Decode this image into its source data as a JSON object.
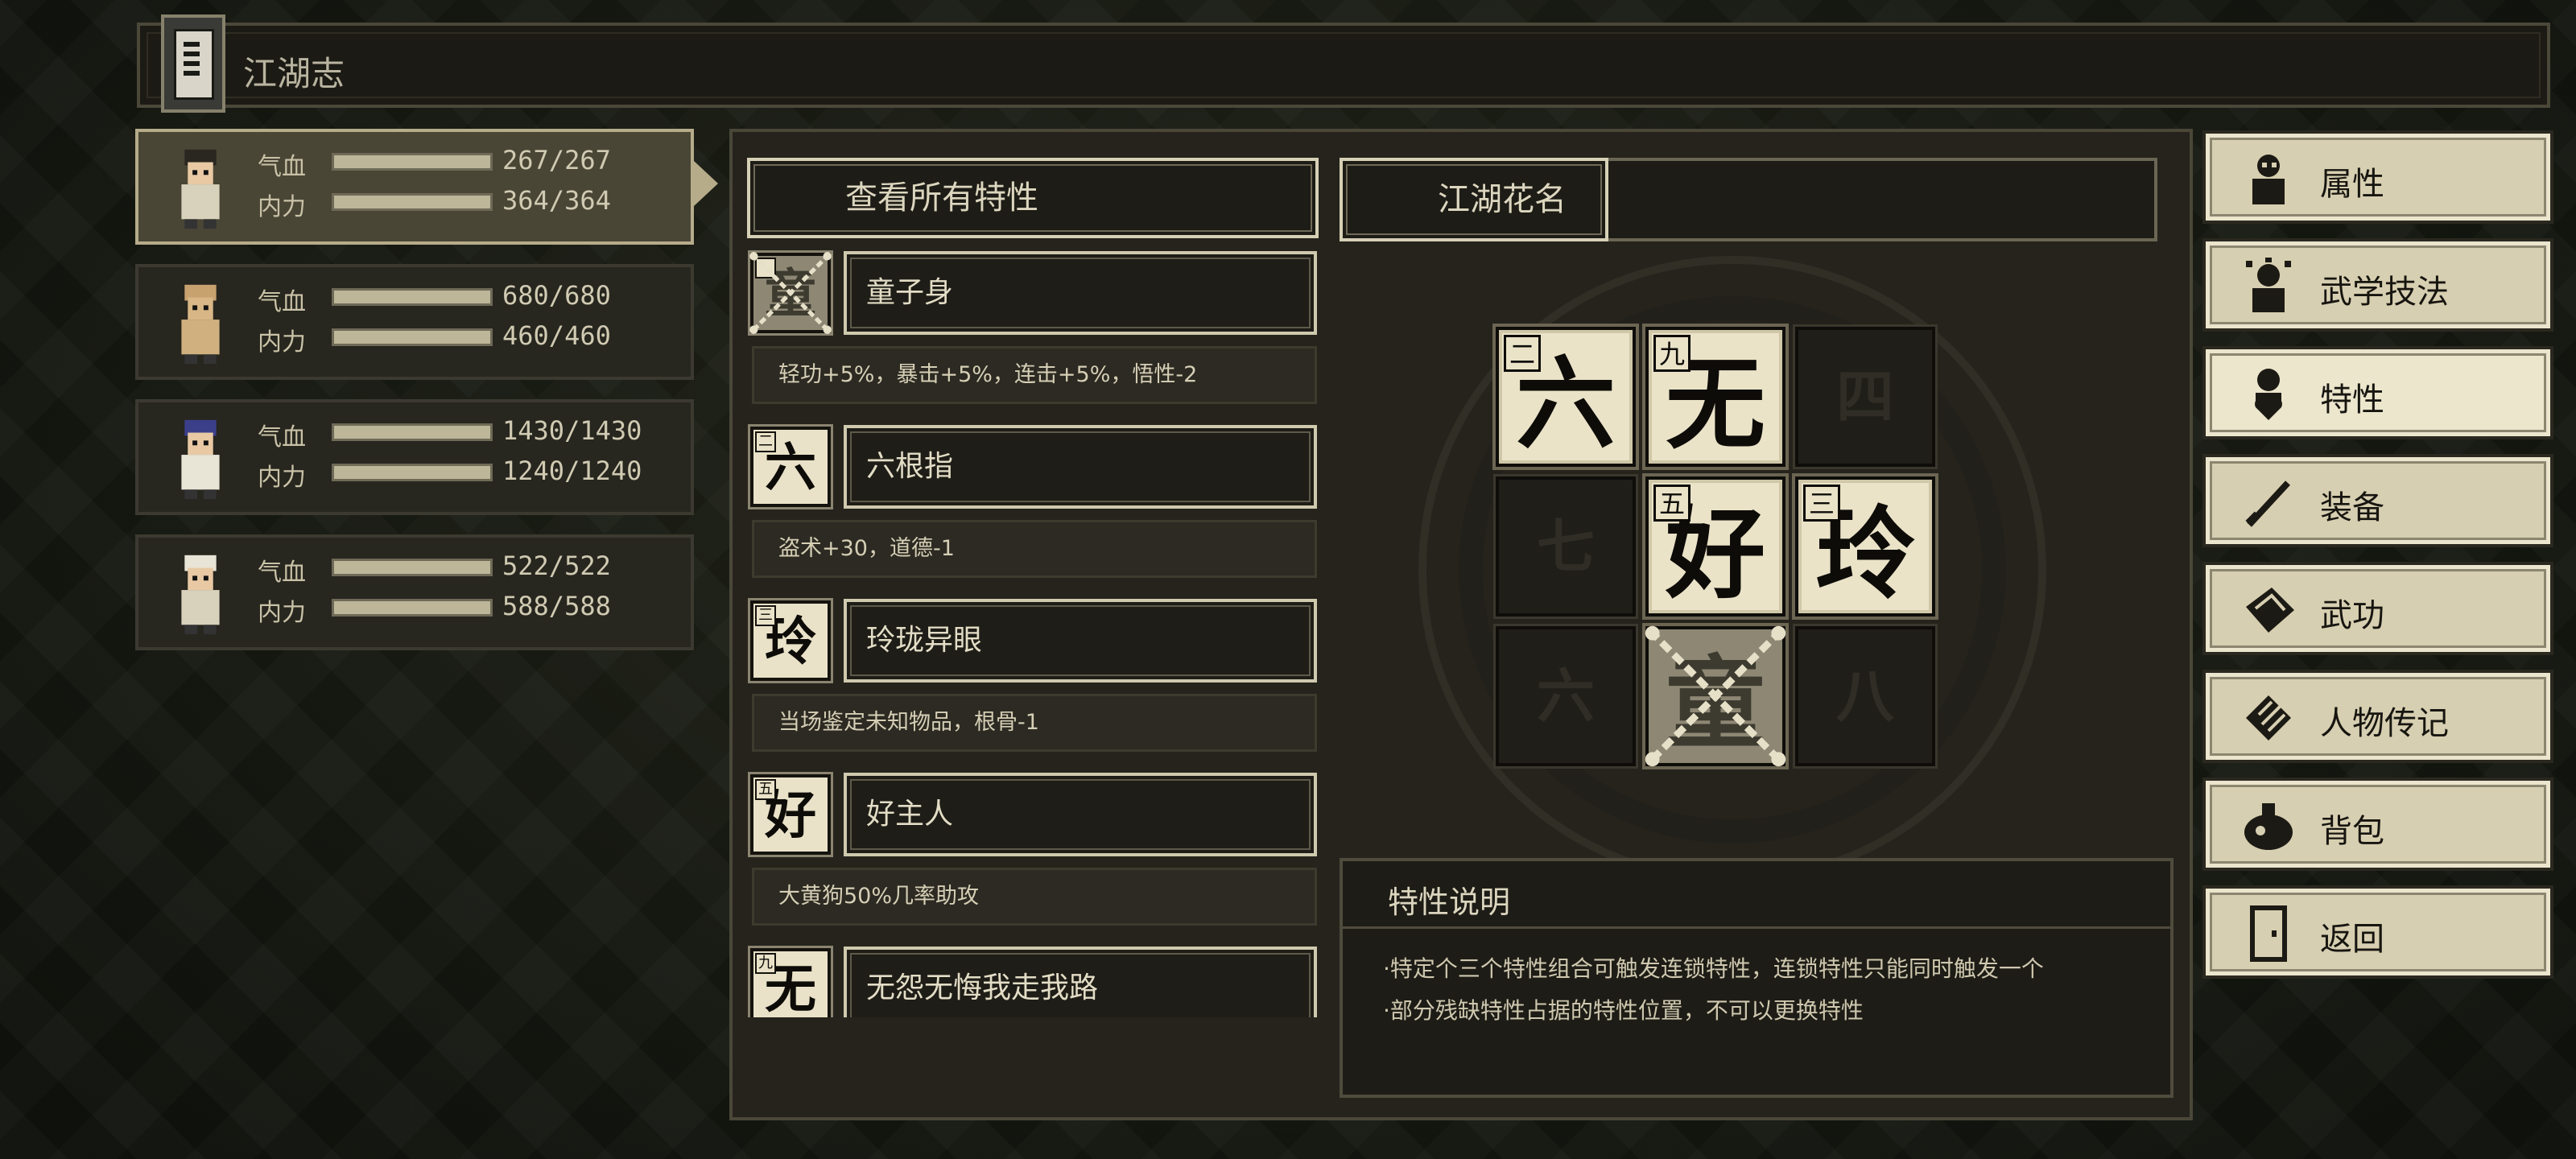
{
  "window": {
    "title": "江湖志"
  },
  "party": [
    {
      "hp_label": "气血",
      "mp_label": "内力",
      "hp": "267/267",
      "mp": "364/364",
      "hp_fill": 1.0,
      "mp_fill": 1.0,
      "selected": true
    },
    {
      "hp_label": "气血",
      "mp_label": "内力",
      "hp": "680/680",
      "mp": "460/460",
      "hp_fill": 1.0,
      "mp_fill": 1.0,
      "selected": false
    },
    {
      "hp_label": "气血",
      "mp_label": "内力",
      "hp": "1430/1430",
      "mp": "1240/1240",
      "hp_fill": 1.0,
      "mp_fill": 1.0,
      "selected": false
    },
    {
      "hp_label": "气血",
      "mp_label": "内力",
      "hp": "522/522",
      "mp": "588/588",
      "hp_fill": 1.0,
      "mp_fill": 1.0,
      "selected": false
    }
  ],
  "traits_panel": {
    "view_all_label": "查看所有特性",
    "items": [
      {
        "glyph": "童",
        "corner": "",
        "name": "童子身",
        "desc": "轻功+5%，暴击+5%，连击+5%，悟性-2",
        "locked": true
      },
      {
        "glyph": "六",
        "corner": "二",
        "name": "六根指",
        "desc": "盗术+30，道德-1",
        "locked": false
      },
      {
        "glyph": "玲",
        "corner": "三",
        "name": "玲珑异眼",
        "desc": "当场鉴定未知物品，根骨-1",
        "locked": false
      },
      {
        "glyph": "好",
        "corner": "五",
        "name": "好主人",
        "desc": "大黄狗50%几率助攻",
        "locked": false
      },
      {
        "glyph": "无",
        "corner": "九",
        "name": "无怨无悔我走我路",
        "desc": "",
        "locked": false
      }
    ]
  },
  "nickname": {
    "label": "江湖花名",
    "grid": [
      {
        "glyph": "六",
        "num": "二",
        "state": "on"
      },
      {
        "glyph": "无",
        "num": "九",
        "state": "on"
      },
      {
        "glyph": "四",
        "num": "",
        "state": "off"
      },
      {
        "glyph": "七",
        "num": "",
        "state": "off"
      },
      {
        "glyph": "好",
        "num": "五",
        "state": "on"
      },
      {
        "glyph": "玲",
        "num": "三",
        "state": "on"
      },
      {
        "glyph": "六",
        "num": "",
        "state": "off"
      },
      {
        "glyph": "童",
        "num": "",
        "state": "locked"
      },
      {
        "glyph": "八",
        "num": "",
        "state": "off"
      }
    ]
  },
  "explanation": {
    "title": "特性说明",
    "lines": [
      "·特定个三个特性组合可触发连锁特性，连锁特性只能同时触发一个",
      "·部分残缺特性占据的特性位置，不可以更换特性"
    ]
  },
  "menu": [
    {
      "label": "属性",
      "icon": "person-icon",
      "active": false
    },
    {
      "label": "武学技法",
      "icon": "martial-person-icon",
      "active": false
    },
    {
      "label": "特性",
      "icon": "heart-person-icon",
      "active": true
    },
    {
      "label": "装备",
      "icon": "sword-icon",
      "active": false
    },
    {
      "label": "武功",
      "icon": "manual-book-icon",
      "active": false
    },
    {
      "label": "人物传记",
      "icon": "scroll-icon",
      "active": false
    },
    {
      "label": "背包",
      "icon": "bag-icon",
      "active": false
    },
    {
      "label": "返回",
      "icon": "door-icon",
      "active": false
    }
  ],
  "colors": {
    "panel": "#25231c",
    "cream": "#eae3c8",
    "frame": "#d6d0b6",
    "text": "#e9e4d2"
  }
}
